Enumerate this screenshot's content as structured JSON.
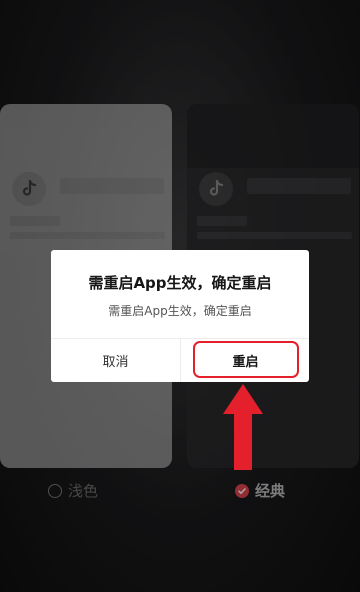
{
  "theme_picker": {
    "options": [
      {
        "label": "浅色",
        "selected": false
      },
      {
        "label": "经典",
        "selected": true
      }
    ]
  },
  "dialog": {
    "title": "需重启App生效，确定重启",
    "message": "需重启App生效，确定重启",
    "cancel_label": "取消",
    "confirm_label": "重启"
  },
  "colors": {
    "accent": "#e0454f",
    "annotation": "#e3202c",
    "dialog_bg": "#ffffff"
  },
  "icons": {
    "app_logo": "tiktok-note-icon",
    "checked": "check-icon"
  }
}
